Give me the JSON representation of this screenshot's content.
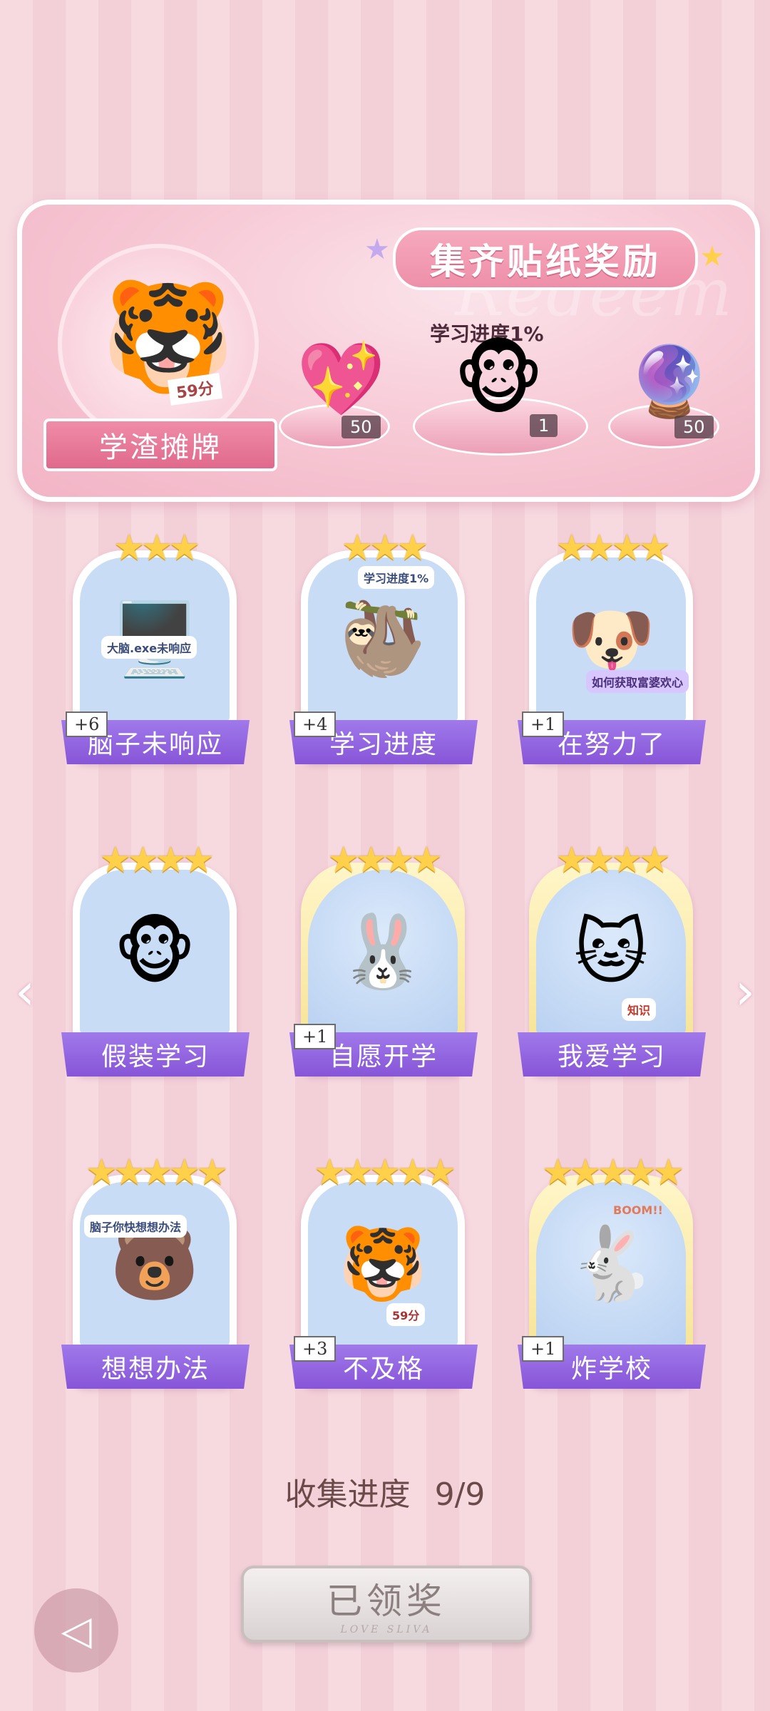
{
  "reward": {
    "title": "集齐贴纸奖励",
    "watermark": "Redeem",
    "avatar_label": "学渣摊牌",
    "avatar_paper_text": "59分",
    "items": [
      {
        "name": "heart-gem",
        "qty": "50",
        "icon": "💖"
      },
      {
        "name": "monkey-sticker",
        "qty": "1",
        "icon": "🐵",
        "caption": "学习进度1%"
      },
      {
        "name": "lightning-orb",
        "qty": "50",
        "icon": "🔮"
      }
    ]
  },
  "cards": [
    {
      "label": "脑子未响应",
      "count": "+6",
      "stars": "★★★",
      "icon": "🖥️",
      "extra": "大脑.exe未响应"
    },
    {
      "label": "学习进度",
      "count": "+4",
      "stars": "★★★",
      "icon": "🦥",
      "extra": "学习进度1%"
    },
    {
      "label": "在努力了",
      "count": "+1",
      "stars": "★★★★",
      "icon": "🐶",
      "extra": "如何获取富婆欢心"
    },
    {
      "label": "假装学习",
      "count": "",
      "stars": "★★★★",
      "icon": "🐵",
      "extra": ""
    },
    {
      "label": "自愿开学",
      "count": "+1",
      "stars": "★★★★",
      "icon": "🐰",
      "extra": ""
    },
    {
      "label": "我爱学习",
      "count": "",
      "stars": "★★★★",
      "icon": "🐱",
      "extra": "知识"
    },
    {
      "label": "想想办法",
      "count": "",
      "stars": "★★★★★",
      "icon": "🐻",
      "extra": "脑子你快想想办法"
    },
    {
      "label": "不及格",
      "count": "+3",
      "stars": "★★★★★",
      "icon": "🐯",
      "extra": "59分"
    },
    {
      "label": "炸学校",
      "count": "+1",
      "stars": "★★★★★",
      "icon": "🐇",
      "extra": "BOOM!!"
    }
  ],
  "progress": {
    "label": "收集进度",
    "value": "9/9"
  },
  "claim": {
    "label": "已领奖",
    "sub": "LOVE SLIVA"
  },
  "nav": {
    "left": "‹",
    "right": "›"
  },
  "colors": {
    "accent_purple": "#8755d8",
    "panel_pink": "#f6c6d3",
    "star_gold": "#ffd14a"
  }
}
